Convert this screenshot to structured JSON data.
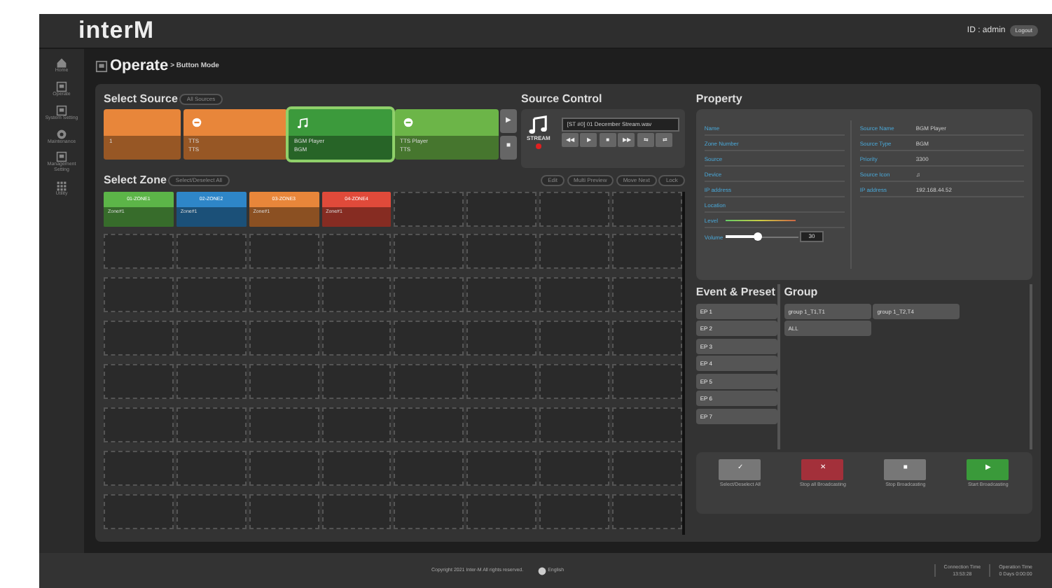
{
  "header": {
    "logo": "interM",
    "user": "ID : admin",
    "logout": "Logout"
  },
  "sidebar": {
    "items": [
      {
        "label": "Home",
        "kind": "home"
      },
      {
        "label": "Operate",
        "kind": "panel"
      },
      {
        "label": "System Setting",
        "kind": "panel"
      },
      {
        "label": "Maintenance",
        "kind": "gear"
      },
      {
        "label": "Management Setting",
        "kind": "panel"
      },
      {
        "label": "Utility",
        "kind": "grid"
      }
    ]
  },
  "page": {
    "title": "Operate",
    "breadcrumb": "> Button Mode"
  },
  "select_source": {
    "title": "Select Source",
    "filter": "All Sources",
    "sources": [
      {
        "name": "1",
        "color": "#e8863a",
        "kind": "plain",
        "selected": false
      },
      {
        "name": "TTS",
        "type": "TTS",
        "color": "#e8863a",
        "kind": "tts",
        "selected": false
      },
      {
        "name": "BGM Player",
        "type": "BGM",
        "color": "#3c9a3c",
        "kind": "stream",
        "selected": true
      },
      {
        "name": "TTS Player",
        "type": "TTS",
        "color": "#6cb548",
        "kind": "tts",
        "selected": false
      }
    ],
    "next": "▶",
    "prev": "■"
  },
  "source_control": {
    "title": "Source Control",
    "label": "STREAM",
    "file": "[ST #0] 01 December Stream.wav",
    "buttons": [
      "◀◀",
      "▶",
      "■",
      "▶▶",
      "⇆",
      "⇄"
    ]
  },
  "select_zone": {
    "title": "Select Zone",
    "select_all": "Select/Deselect All",
    "actions": [
      "Edit",
      "Multi Preview",
      "Move Next",
      "Lock"
    ],
    "zones": [
      {
        "name": "01-ZONE1",
        "source": "Zone#1",
        "color": "#5cb548"
      },
      {
        "name": "02-ZONE2",
        "source": "Zone#1",
        "color": "#2e86c8"
      },
      {
        "name": "03-ZONE3",
        "source": "Zone#1",
        "color": "#e8863a"
      },
      {
        "name": "04-ZONE4",
        "source": "Zone#1",
        "color": "#e04a3a"
      }
    ]
  },
  "property": {
    "title": "Property",
    "left": [
      "Name",
      "Zone Number",
      "Source",
      "Device",
      "IP address",
      "Location",
      "Level"
    ],
    "volume_label": "Volume",
    "volume": {
      "level": 0.45
    },
    "volume_value": "30",
    "right": [
      {
        "label": "Source Name",
        "value": "BGM Player"
      },
      {
        "label": "Source Type",
        "value": "BGM"
      },
      {
        "label": "Priority",
        "value": "3300"
      },
      {
        "label": "Source Icon",
        "value": "♫"
      },
      {
        "label": "IP address",
        "value": "192.168.44.52"
      }
    ]
  },
  "event_preset": {
    "title": "Event & Preset",
    "items": [
      "EP 1",
      "EP 2",
      "EP 3",
      "EP 4",
      "EP 5",
      "EP 6",
      "EP 7"
    ]
  },
  "group": {
    "title": "Group",
    "items": [
      "group 1_T1,T1",
      "group 1_T2,T4",
      "ALL"
    ]
  },
  "broadcast_buttons": [
    {
      "kind": "select",
      "symbol": "✓",
      "label": "Select/Deselect All"
    },
    {
      "kind": "stopall",
      "symbol": "✕",
      "label": "Stop all Broadcasting"
    },
    {
      "kind": "stop",
      "symbol": "■",
      "label": "Stop Broadcasting"
    },
    {
      "kind": "start",
      "symbol": "▶",
      "label": "Start Broadcasting"
    }
  ],
  "footer": {
    "copyright": "Copyright 2021 Inter-M All rights reserved.",
    "language": "English",
    "connection_label": "Connection Time",
    "connection_value": "13:53:28",
    "operation_label": "Operation Time",
    "operation_value": "0 Days 0:00:00"
  }
}
